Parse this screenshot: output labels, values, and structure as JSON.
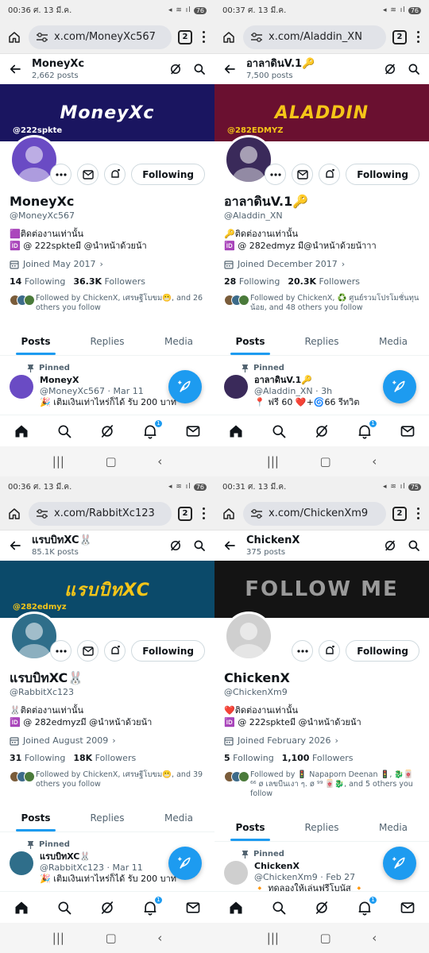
{
  "panels": [
    {
      "status": {
        "time": "00:36 ศ. 13 มี.ค.",
        "icons": "◂ ≋ ıl",
        "battery": "76"
      },
      "browser": {
        "url": "x.com/MoneyXc567",
        "tab_count": "2"
      },
      "profile": {
        "name": "MoneyXc",
        "post_count": "2,662 posts",
        "banner_text": "MoneyXc",
        "banner_sub": "@222spkte",
        "display_name": "MoneyXc",
        "handle": "@MoneyXc567",
        "bio_line1": "🟪ติดต่องานเท่านั้น",
        "bio_line2": "🆔 @ 222spkteมี @นำหน้าด้วยน้า",
        "joined": "Joined May 2017",
        "following_count": "14",
        "following_label": "Following",
        "followers_count": "36.3K",
        "followers_label": "Followers",
        "followed_by": "Followed by ChickenX, เศรษฐีโบขม😬, and 26 others you follow",
        "follow_button": "Following"
      },
      "tabs": [
        "Posts",
        "Replies",
        "Media"
      ],
      "post": {
        "pinned": "Pinned",
        "author": "MoneyX",
        "meta": "@MoneyXc567 · Mar 11",
        "text": "🎉 เติมเงินเท่าไหร่ก็ได้ รับ 200 บาท"
      },
      "nav": {
        "badge": "1"
      },
      "colors": {
        "banner_bg": "#1a1560",
        "banner_text": "#ffffff",
        "avatar": "#6a4bc4"
      }
    },
    {
      "status": {
        "time": "00:37 ศ. 13 มี.ค.",
        "icons": "◂ ≋ ıl",
        "battery": "76"
      },
      "browser": {
        "url": "x.com/Aladdin_XN",
        "tab_count": "2"
      },
      "profile": {
        "name": "อาลาดินV.1🔑",
        "post_count": "7,500 posts",
        "banner_text": "ALADDIN",
        "banner_sub": "@282EDMYZ",
        "display_name": "อาลาดินV.1🔑",
        "handle": "@Aladdin_XN",
        "bio_line1": "🔑ติดต่องานเท่านั้น",
        "bio_line2": "🆔 @ 282edmyz มี@นำหน้าด้วยน้าาา",
        "joined": "Joined December 2017",
        "following_count": "28",
        "following_label": "Following",
        "followers_count": "20.3K",
        "followers_label": "Followers",
        "followed_by": "Followed by ChickenX, ♻️ ศูนย์รวมโปรโมชั่นทุนน้อย, and 48 others you follow",
        "follow_button": "Following"
      },
      "tabs": [
        "Posts",
        "Replies",
        "Media"
      ],
      "post": {
        "pinned": "Pinned",
        "author": "อาลาดินV.1🔑",
        "meta": "@Aladdin_XN · 3h",
        "text": "📍 ฟรี 60 ❤️+🌀66 รีทวิต"
      },
      "nav": {
        "badge": "1"
      },
      "colors": {
        "banner_bg": "#6a1030",
        "banner_text": "#f5c518",
        "avatar": "#3a2a5a"
      }
    },
    {
      "status": {
        "time": "00:36 ศ. 13 มี.ค.",
        "icons": "◂ ≋ ıl",
        "battery": "76"
      },
      "browser": {
        "url": "x.com/RabbitXc123",
        "tab_count": "2"
      },
      "profile": {
        "name": "แรบบิทXC🐰",
        "post_count": "85.1K posts",
        "banner_text": "แรบบิทXC",
        "banner_sub": "@282edmyz",
        "display_name": "แรบบิทXC🐰",
        "handle": "@RabbitXc123",
        "bio_line1": "🐰ติดต่องานเท่านั้น",
        "bio_line2": "🆔 @ 282edmyzมี @นำหน้าด้วยน้า",
        "joined": "Joined August 2009",
        "following_count": "31",
        "following_label": "Following",
        "followers_count": "18K",
        "followers_label": "Followers",
        "followed_by": "Followed by ChickenX, เศรษฐีโบขม😬, and 39 others you follow",
        "follow_button": "Following"
      },
      "tabs": [
        "Posts",
        "Replies",
        "Media"
      ],
      "post": {
        "pinned": "Pinned",
        "author": "แรบบิทXC🐰",
        "meta": "@RabbitXc123 · Mar 11",
        "text": "🎉 เติมเงินเท่าไหร่ก็ได้ รับ 200 บาท"
      },
      "nav": {
        "badge": "1"
      },
      "colors": {
        "banner_bg": "#0b4a6a",
        "banner_text": "#f5c518",
        "avatar": "#2f6e8a"
      }
    },
    {
      "status": {
        "time": "00:31 ศ. 13 มี.ค.",
        "icons": "◂ ≋ ıl",
        "battery": "75"
      },
      "browser": {
        "url": "x.com/ChickenXm9",
        "tab_count": "2"
      },
      "profile": {
        "name": "ChickenX",
        "post_count": "375 posts",
        "banner_text": "FOLLOW ME",
        "banner_sub": "",
        "display_name": "ChickenX",
        "handle": "@ChickenXm9",
        "bio_line1": "❤️ติดต่องานเท่านั้น",
        "bio_line2": "🆔 @ 222spkteมี @นำหน้าด้วยน้า",
        "joined": "Joined February 2026",
        "following_count": "5",
        "following_label": "Following",
        "followers_count": "1,100",
        "followers_label": "Followers",
        "followed_by": "Followed by 🚦 Napaporn Deenan 🚦, 🐉🀄 ⁶⁶ ø เลขบีนเงา ๆ. ø ⁹⁹ 🀄🐉, and 5 others you follow",
        "follow_button": "Following"
      },
      "tabs": [
        "Posts",
        "Replies",
        "Media"
      ],
      "post": {
        "pinned": "Pinned",
        "author": "ChickenX",
        "meta": "@ChickenXm9 · Feb 27",
        "text": "🔸 ทดลองให้เล่นฟรีโบนัส 🔸"
      },
      "nav": {
        "badge": "1"
      },
      "colors": {
        "banner_bg": "#141414",
        "banner_text": "#9a9a9a",
        "avatar": "#cfcfcf"
      }
    }
  ]
}
